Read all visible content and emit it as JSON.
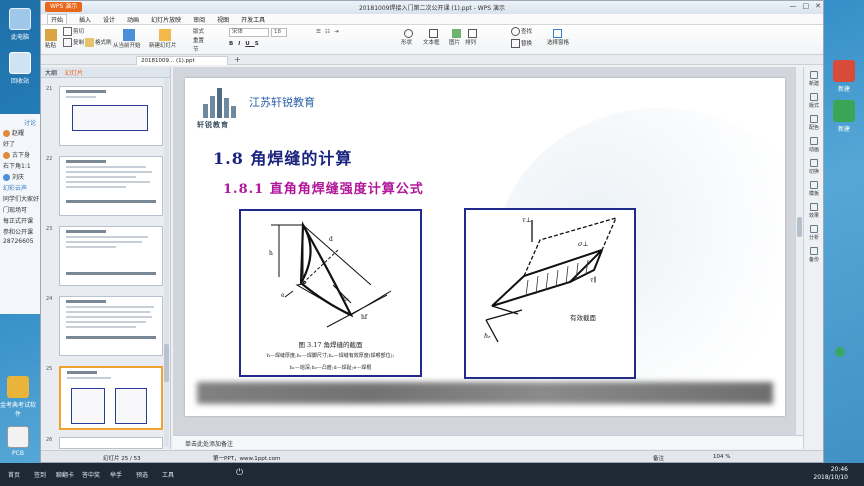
{
  "desktop": {
    "icons": [
      "此电脑",
      "回收站",
      "金考典考试软件",
      "PCB"
    ],
    "right_icons": [
      "新建",
      "新建"
    ]
  },
  "chat": {
    "tab": "讨论",
    "lines": [
      "赵耀",
      "好了",
      "古下身",
      "右下角1:1",
      "刘庆",
      "幻彩云声",
      "同学们大家好",
      "门现场可",
      "每正式开课",
      "参和公开课",
      "28726605"
    ]
  },
  "window": {
    "app_badge": "WPS 演示",
    "title": "20181009焊接入门第二次公开课 (1).ppt - WPS 演示",
    "controls": [
      "—",
      "□",
      "✕"
    ]
  },
  "menu": [
    "开始",
    "插入",
    "设计",
    "动画",
    "幻灯片放映",
    "审阅",
    "视图",
    "开发工具"
  ],
  "ribbon": {
    "paste": "粘贴",
    "cut": "剪切",
    "copy": "复制",
    "format_painter": "格式刷",
    "from_current": "从当前开始",
    "new_slide": "新建幻灯片",
    "layout": "版式",
    "reset": "重置",
    "section": "节",
    "font": "宋体",
    "size": "18",
    "shape": "形状",
    "textbox": "文本框",
    "picture": "图片",
    "arrange": "排列",
    "find": "查找",
    "replace": "替换",
    "select_pane": "选择窗格"
  },
  "doc_tab": "20181009... (1).ppt",
  "pane": {
    "tabs": [
      "大纲",
      "幻灯片"
    ],
    "thumb_numbers": [
      "21",
      "22",
      "23",
      "24",
      "25",
      "26"
    ]
  },
  "slide": {
    "logo_sub": "轩锐教育",
    "brand": "江苏轩锐教育",
    "h1": "1.8   角焊缝的计算",
    "h2": "1.8.1   直角角焊缝强度计算公式",
    "fig1": {
      "caption": "图 3.17   角焊缝的截面",
      "legend1": "h—焊缝厚度;h₁—焊脚尺寸;hₑ—焊缝有效厚度(焊喉部位);",
      "legend2": "h₁—熔深;h₂—凸度;d—焊趾;e—焊根"
    },
    "fig2": {
      "label": "有效截面"
    }
  },
  "notes": "单击此处添加备注",
  "status": {
    "slide_of": "幻灯片 25 / 53",
    "theme": "第一PPT，www.1ppt.com",
    "notes_btn": "备注",
    "zoom": "104 %"
  },
  "tools": [
    "新建",
    "版式",
    "配色",
    "动画",
    "切换",
    "模板",
    "效果",
    "分析",
    "备份"
  ],
  "taskbar": {
    "items": [
      "首页",
      "签到",
      "聊翻卡",
      "答中奖",
      "举手",
      "预选",
      "工具"
    ],
    "time": "20:46",
    "date": "2018/10/10"
  }
}
